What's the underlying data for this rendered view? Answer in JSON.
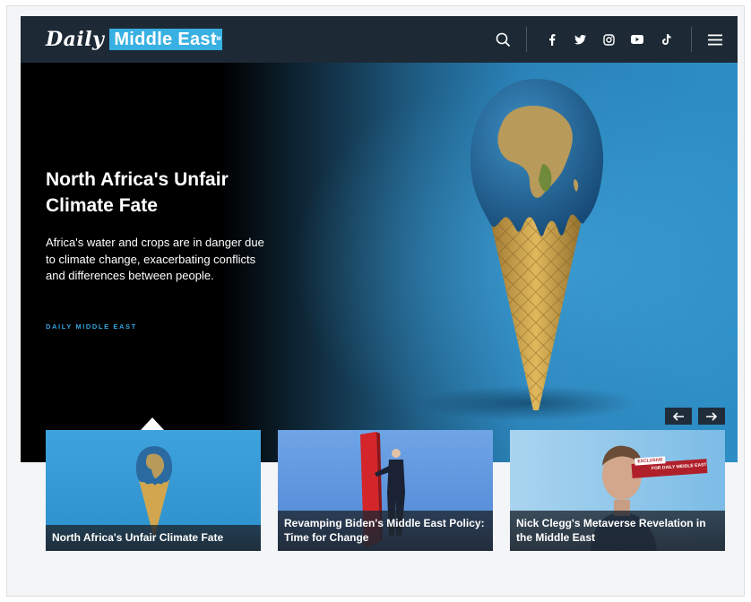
{
  "header": {
    "logo_daily": "Daily",
    "logo_middle_east": "Middle East",
    "logo_tm": "TM",
    "icons": [
      "search-icon",
      "facebook-icon",
      "twitter-icon",
      "instagram-icon",
      "youtube-icon",
      "tiktok-icon",
      "menu-icon"
    ]
  },
  "hero": {
    "title": "North Africa's Unfair Climate Fate",
    "description": "Africa's water and crops are in danger due to climate change, exacerbating conflicts and differences between people.",
    "source": "DAILY MIDDLE EAST",
    "prev_label": "←",
    "next_label": "→"
  },
  "cards": [
    {
      "title": "North Africa's Unfair Climate Fate"
    },
    {
      "title": "Revamping Biden's Middle East Policy: Time for Change"
    },
    {
      "title": "Nick Clegg's Metaverse Revelation in the Middle East",
      "badge_top": "EXCLUSIVE",
      "badge_bottom": "FOR DAILY MIDDLE EAST"
    }
  ],
  "colors": {
    "accent": "#39b0e2",
    "header_bg": "#1d2a36",
    "hero_blue": "#2d8ec6"
  }
}
